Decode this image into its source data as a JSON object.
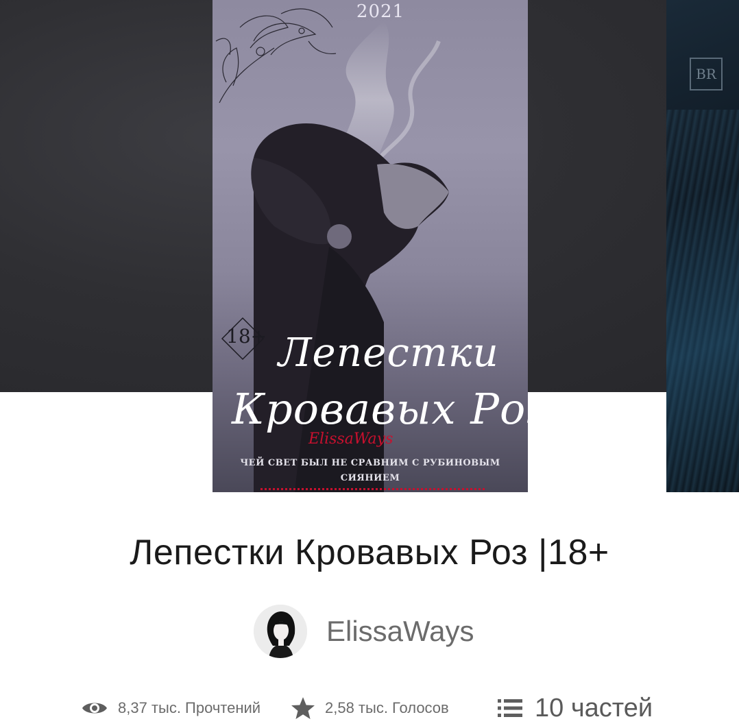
{
  "cover": {
    "year": "2021",
    "age_rating": "18+",
    "title_line1": "Лепестки",
    "title_line2": "Кровавых Роз",
    "author_signature": "ElissaWays",
    "tagline_line1": "ЧЕЙ СВЕТ БЫЛ НЕ СРАВНИМ С РУБИНОВЫМ",
    "tagline_line2": "СИЯНИЕМ"
  },
  "next_cover": {
    "logo": "BR"
  },
  "book": {
    "title": "Лепестки Кровавых Роз |18+",
    "author": "ElissaWays"
  },
  "stats": {
    "reads": "8,37 тыс. Прочтений",
    "votes": "2,58 тыс. Голосов",
    "parts": "10 частей"
  },
  "icons": {
    "reads": "eye-icon",
    "votes": "star-icon",
    "parts": "list-icon"
  },
  "colors": {
    "accent_red": "#c8102e",
    "text_dark": "#1a1a1a",
    "text_muted": "#6b6b6b",
    "icon_gray": "#5e5e5e"
  }
}
